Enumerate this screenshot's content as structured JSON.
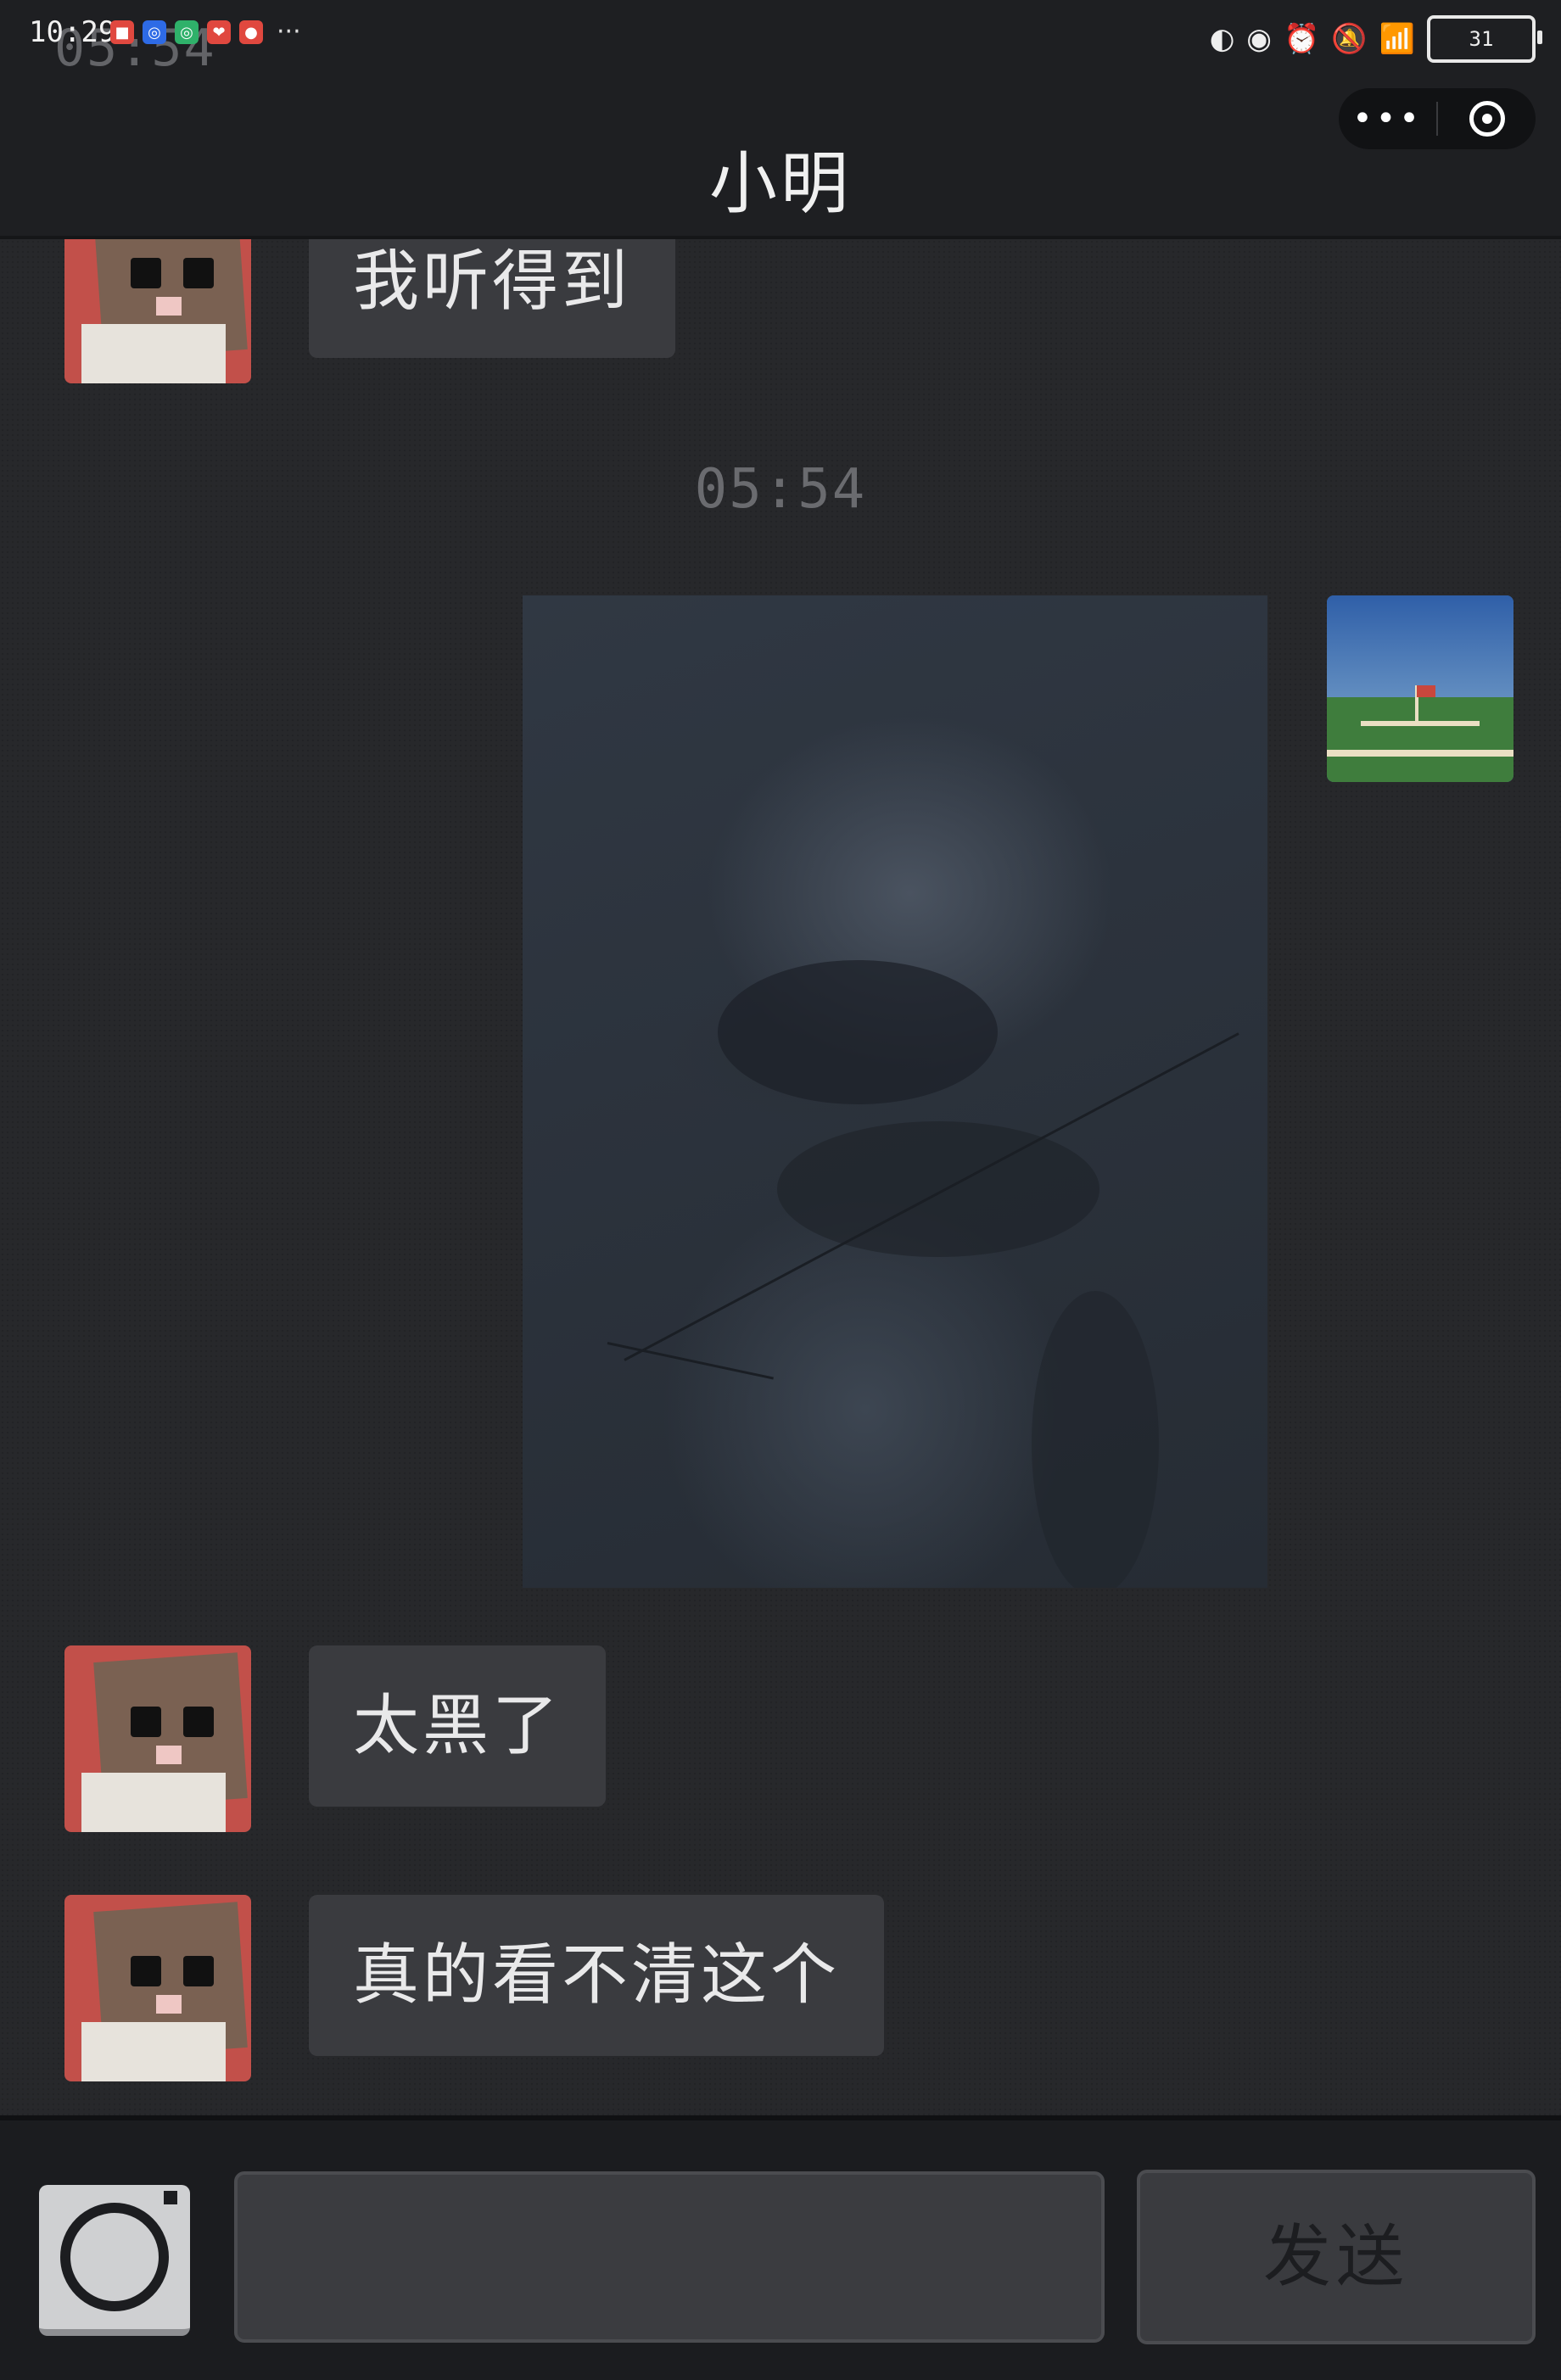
{
  "status_bar": {
    "time": "10:29",
    "ghost_time": "05:54",
    "more": "···",
    "battery": "31"
  },
  "nav": {
    "title": "小明",
    "more_label": "•••"
  },
  "chat": {
    "messages": [
      {
        "side": "left",
        "text": "我听得到"
      },
      {
        "side": "right",
        "type": "image"
      },
      {
        "side": "left",
        "text": "太黑了"
      },
      {
        "side": "left",
        "text": "真的看不清这个"
      }
    ],
    "timestamp": "05:54"
  },
  "composer": {
    "input_value": "",
    "send_label": "发送"
  },
  "colors": {
    "background": "#27282b",
    "bubble": "#3a3b3f",
    "bar": "#1e1f22",
    "avatar_red": "#c2504a"
  },
  "icons": [
    "camera-icon",
    "more-icon",
    "target-icon",
    "wifi-icon",
    "bell-off-icon",
    "alarm-icon",
    "eye-icon",
    "battery-icon"
  ]
}
